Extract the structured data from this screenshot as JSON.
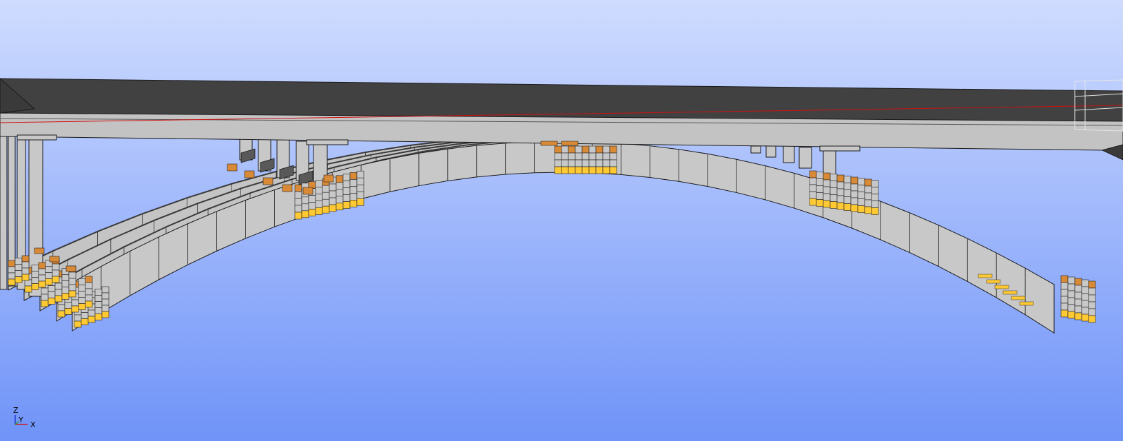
{
  "viewport": {
    "background_top": "#cfdcff",
    "background_bottom": "#6f93f8"
  },
  "axes_triad": {
    "z_label": "Z",
    "y_label": "Y",
    "x_label": "X",
    "z_color": "#2b3cd0",
    "y_color": "#2aa02a",
    "x_color": "#d01a1a"
  },
  "model": {
    "deck_top_color": "#414141",
    "deck_side_color": "#c3c3c3",
    "concrete_color": "#c8c8c8",
    "edge_color": "#1a1a1a",
    "reference_line_color": "#d01010",
    "support_zone_color": "#ffc933",
    "support_zone_alt_color": "#d98a36"
  }
}
